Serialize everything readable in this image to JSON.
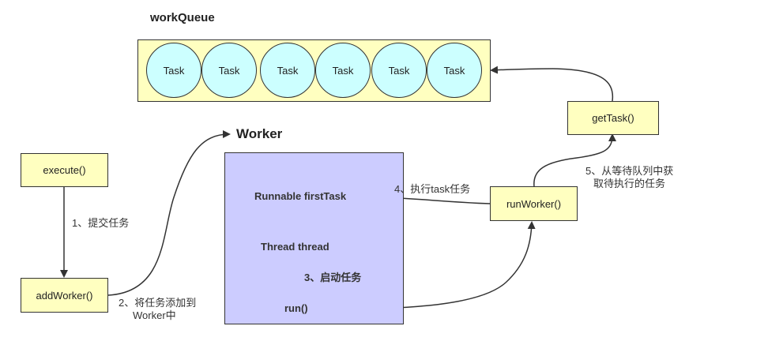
{
  "queue": {
    "title": "workQueue",
    "tasks": [
      "Task",
      "Task",
      "Task",
      "Task",
      "Task",
      "Task"
    ]
  },
  "worker": {
    "title": "Worker",
    "first_task": "Runnable firstTask",
    "thread": "Thread thread",
    "run": "run()"
  },
  "boxes": {
    "execute": "execute()",
    "add_worker": "addWorker()",
    "run_worker": "runWorker()",
    "get_task": "getTask()"
  },
  "steps": {
    "s1": "1、提交任务",
    "s2_line1": "2、将任务添加到",
    "s2_line2": "Worker中",
    "s3": "3、启动任务",
    "s4": "4、执行task任务",
    "s5_line1": "5、从等待队列中获",
    "s5_line2": "取待执行的任务"
  }
}
